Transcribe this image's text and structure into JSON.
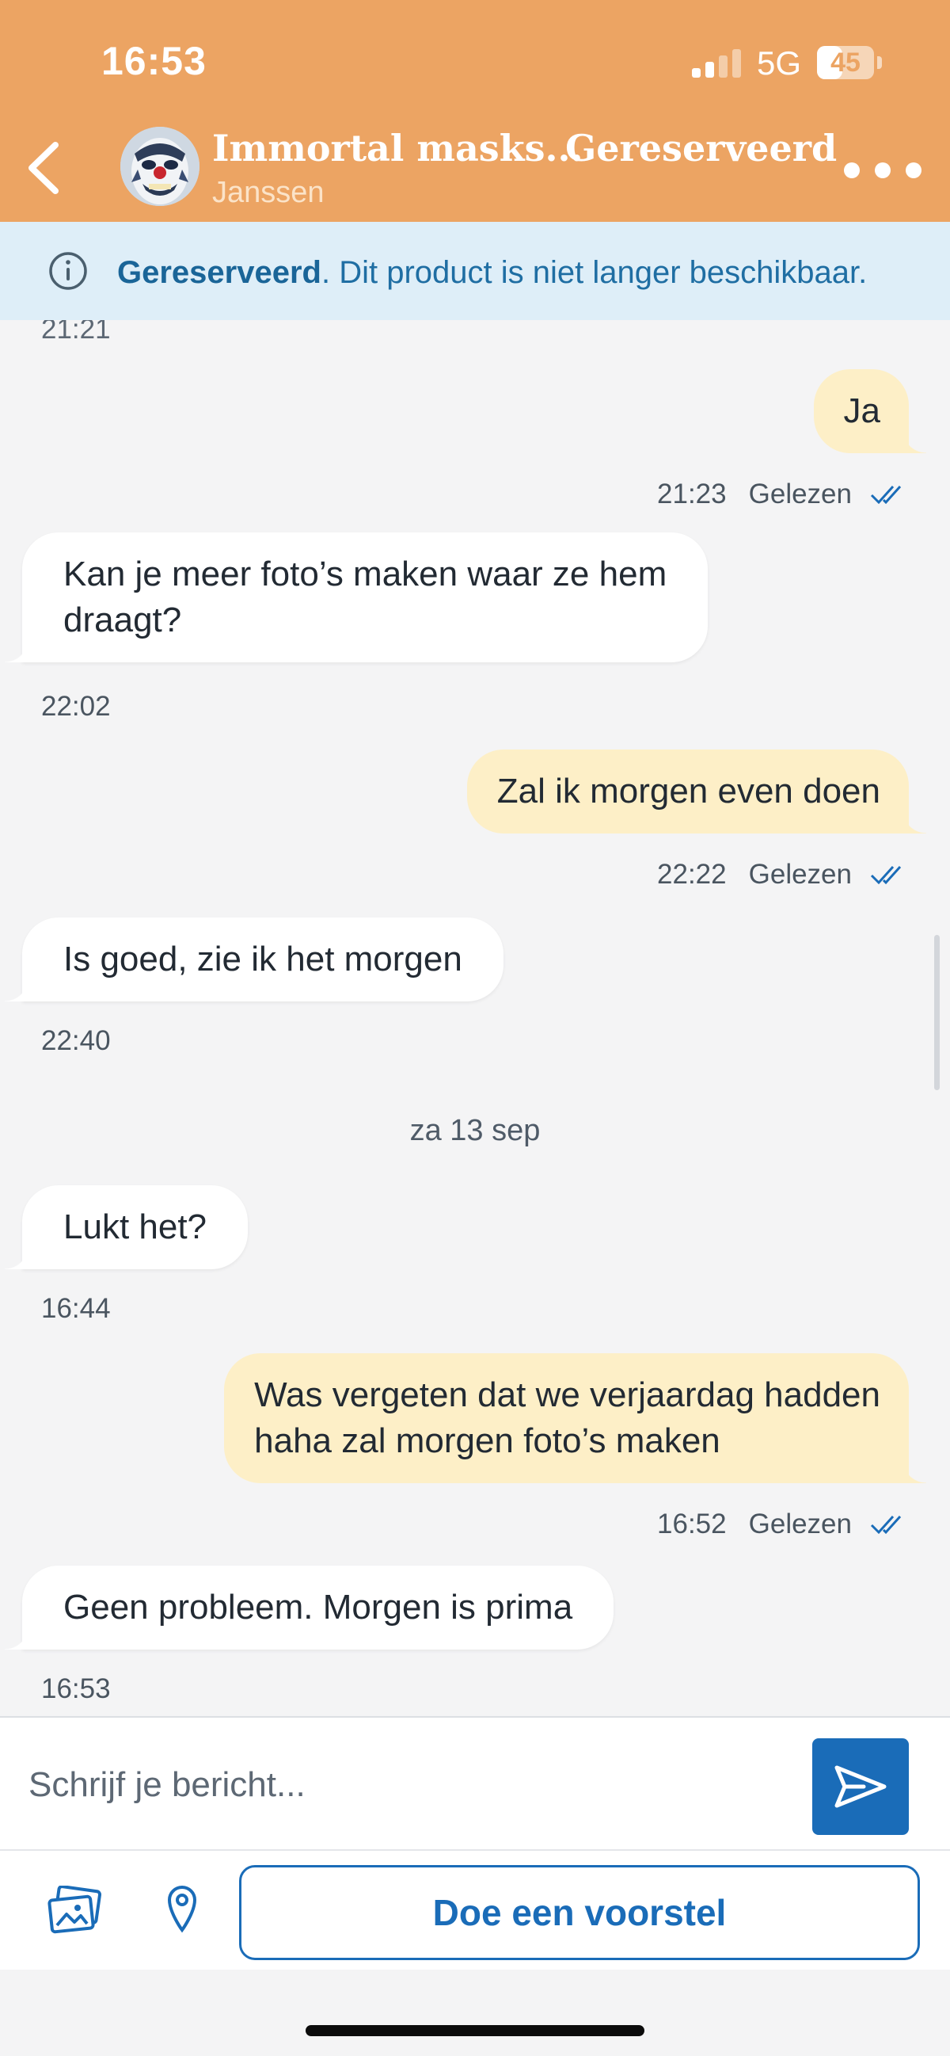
{
  "status_bar": {
    "time": "16:53",
    "network": "5G",
    "battery": "45",
    "battery_level": 0.45
  },
  "header": {
    "item_title": "Immortal masks...",
    "seller": "Janssen",
    "status": "Gereserveerd",
    "icons": [
      "back-icon",
      "more-icon"
    ],
    "bg_color": "#eca463"
  },
  "banner": {
    "bold": "Gereserveerd",
    "text": ". Dit product is niet langer beschikbaar.",
    "color": "#1f6ea3"
  },
  "chat": {
    "top_partial_time": "21:21",
    "messages": [
      {
        "side": "out",
        "text": "Ja",
        "time": "21:23",
        "status": "Gelezen"
      },
      {
        "side": "in",
        "lines": [
          "Kan je meer foto’s maken waar ze hem",
          "draagt?"
        ],
        "time": "22:02"
      },
      {
        "side": "out",
        "text": "Zal ik morgen even doen",
        "time": "22:22",
        "status": "Gelezen"
      },
      {
        "side": "in",
        "text": "Is goed, zie ik het morgen",
        "time": "22:40"
      },
      {
        "side": "in",
        "text": "Lukt het?",
        "time": "16:44"
      },
      {
        "side": "out",
        "lines": [
          "Was vergeten dat we verjaardag hadden",
          "haha zal morgen foto’s maken"
        ],
        "time": "16:52",
        "status": "Gelezen"
      },
      {
        "side": "in",
        "text": "Geen probleem. Morgen is prima",
        "time": "16:53"
      }
    ],
    "date_separator": "za 13 sep",
    "incoming_color": "#ffffff",
    "outgoing_color": "#fdefc7"
  },
  "composer": {
    "placeholder": "Schrijf je bericht...",
    "value": "",
    "send_icon": "send-icon"
  },
  "toolbar": {
    "photo_icon": "photos-icon",
    "location_icon": "location-pin-icon",
    "offer_label": "Doe een voorstel",
    "accent": "#1a6cb8"
  }
}
